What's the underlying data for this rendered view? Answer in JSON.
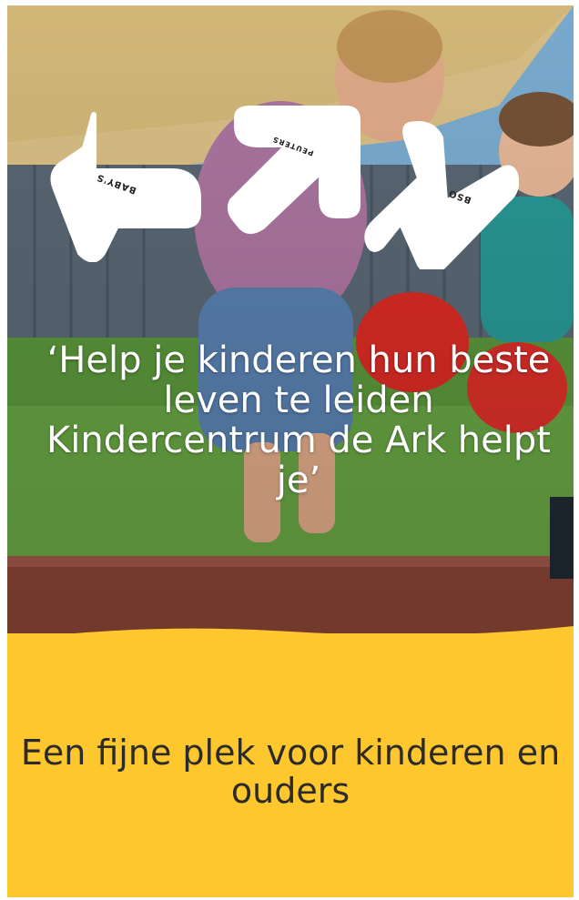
{
  "nav": {
    "babys_label": "BABY'S",
    "peuters_label": "PEUTERS",
    "bso_label": "BSO"
  },
  "hero": {
    "quote": "‘Help je kinderen hun beste leven te leiden Kindercentrum de Ark helpt je’"
  },
  "section": {
    "tagline": "Een fijne plek voor kinderen en ouders"
  },
  "colors": {
    "accent_yellow": "#fec72e",
    "nav_white": "#ffffff",
    "tagline_text": "#2b2b2b"
  },
  "icons": [
    "arrow-down-left-icon",
    "arrow-up-right-icon"
  ]
}
